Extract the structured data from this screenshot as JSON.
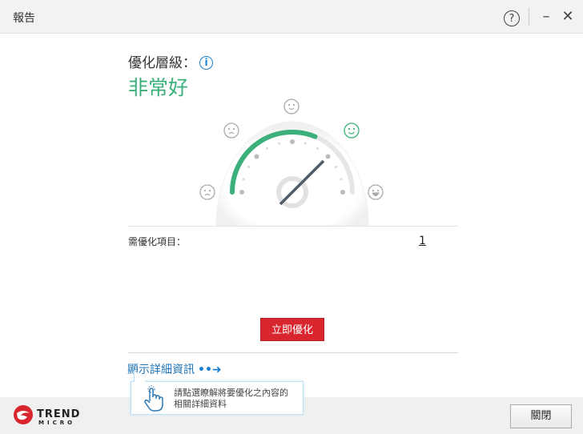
{
  "window": {
    "title": "報告",
    "help": "?",
    "minimize": "–",
    "close": "✕"
  },
  "main": {
    "level_label": "優化層級：",
    "info": "i",
    "level_value": "非常好",
    "gauge_level_fraction": 0.8,
    "items_label": "需優化項目：",
    "items_count": "1",
    "optimize_button": "立即優化",
    "details_link": "顯示詳細資訊",
    "details_arrow": "••➜",
    "tooltip": [
      "請點選瞭解將要優化之內容的",
      "相關詳細資料"
    ]
  },
  "footer": {
    "brand": "TREND",
    "brand_sub": "MICRO",
    "close_button": "關閉"
  },
  "colors": {
    "green": "#3cb07a",
    "red": "#d9262e",
    "blue": "#1f74b8"
  }
}
